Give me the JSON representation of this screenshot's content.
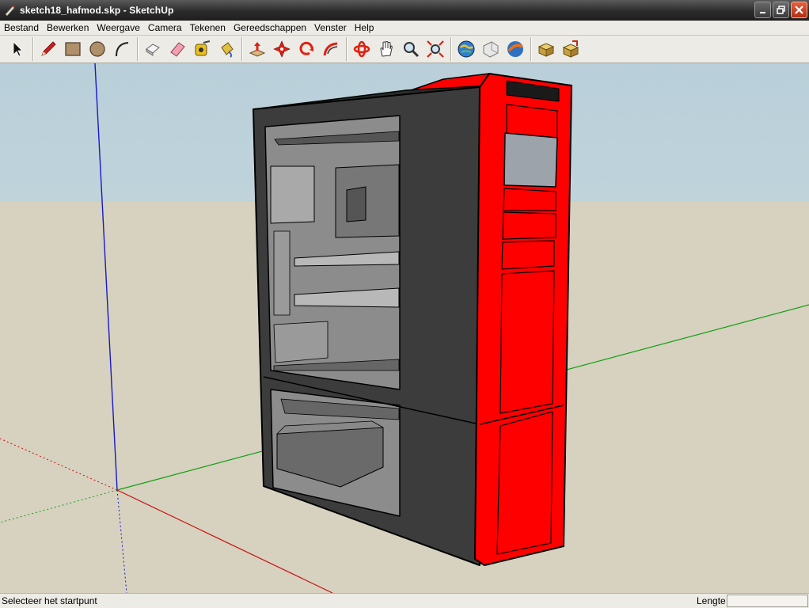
{
  "window": {
    "title": "sketch18_hafmod.skp - SketchUp",
    "controls": [
      "minimize-icon",
      "restore-icon",
      "close-icon"
    ]
  },
  "menu": {
    "items": [
      "Bestand",
      "Bewerken",
      "Weergave",
      "Camera",
      "Tekenen",
      "Gereedschappen",
      "Venster",
      "Help"
    ]
  },
  "toolbar": {
    "groups": [
      [
        "select-arrow-icon"
      ],
      [
        "pencil-line-icon",
        "rectangle-icon",
        "circle-icon",
        "arc-icon"
      ],
      [
        "make-component-icon",
        "eraser-icon",
        "tape-measure-icon",
        "paint-bucket-icon"
      ],
      [
        "push-pull-icon",
        "move-icon",
        "rotate-icon",
        "follow-me-icon"
      ],
      [
        "orbit-icon",
        "pan-hand-icon",
        "zoom-icon",
        "zoom-extents-icon"
      ],
      [
        "get-models-icon",
        "share-model-icon",
        "google-earth-icon"
      ],
      [
        "get-components-icon",
        "share-component-icon"
      ]
    ]
  },
  "colors": {
    "case_red": "#ff0000",
    "case_black": "#3c3c3c",
    "window_gray": "#8e8e8e",
    "ground": "#d6d2bf",
    "sky": "#c3d6df",
    "axis_red": "#cc0000",
    "axis_green": "#00aa00",
    "axis_blue": "#0000cc"
  },
  "status": {
    "message": "Selecteer het startpunt",
    "measure_label": "Lengte",
    "measure_value": ""
  }
}
